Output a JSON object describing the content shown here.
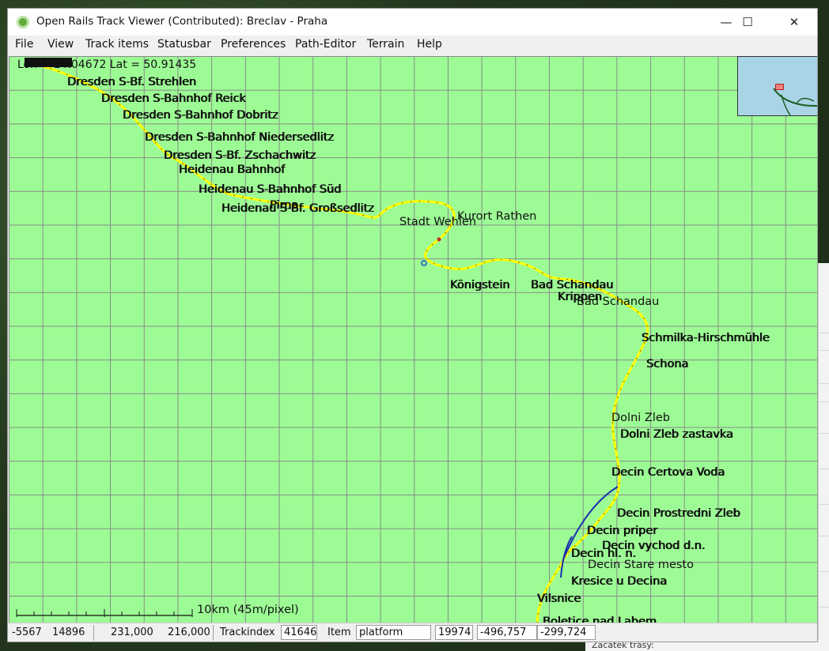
{
  "window": {
    "title": "Open Rails Track Viewer (Contributed): Breclav - Praha",
    "minimize": "—",
    "maximize": "☐",
    "close": "✕"
  },
  "menu": [
    "File",
    "View",
    "Track items",
    "Statusbar",
    "Preferences",
    "Path-Editor",
    "Terrain",
    "Help"
  ],
  "map": {
    "coordinates": "Lon = 14.04672  Lat = 50.91435",
    "scale_label": "10km (45m/pixel)",
    "stations": [
      {
        "name": "Dresden S-Bf. Strehlen"
      },
      {
        "name": "Dresden S-Bahnhof Reick"
      },
      {
        "name": "Dresden S-Bahnhof Dobritz"
      },
      {
        "name": "Dresden S-Bahnhof Niedersedlitz"
      },
      {
        "name": "Dresden S-Bf. Zschachwitz"
      },
      {
        "name": "Heidenau Bahnhof"
      },
      {
        "name": "Heidenau S-Bahnhof Süd"
      },
      {
        "name": "Heidenau S-Bf. Großsedlitz"
      },
      {
        "name": "Pirna"
      },
      {
        "name": "Stadt Wehlen"
      },
      {
        "name": "Kurort Rathen"
      },
      {
        "name": "Königstein"
      },
      {
        "name": "Bad Schandau"
      },
      {
        "name": "Krippen"
      },
      {
        "name": "Bad Schandau"
      },
      {
        "name": "Schmilka-Hirschmühle"
      },
      {
        "name": "Schona"
      },
      {
        "name": "Dolni Zleb"
      },
      {
        "name": "Dolni Zleb zastavka"
      },
      {
        "name": "Decin Certova Voda"
      },
      {
        "name": "Decin Prostredni Zleb"
      },
      {
        "name": "Decin priper"
      },
      {
        "name": "Decin vychod d.n."
      },
      {
        "name": "Decin hl. n."
      },
      {
        "name": "Decin Stare mesto"
      },
      {
        "name": "Kresice u Decina"
      },
      {
        "name": "Vilsnice"
      },
      {
        "name": "Boletice nad Labem"
      }
    ],
    "colors": {
      "background": "#9cfb94",
      "track": "#ffff00",
      "grid": "#8a8a8a"
    }
  },
  "statusbar": {
    "tile_x": "-5567",
    "tile_z": "14896",
    "x": "231,000",
    "z": "216,000",
    "trackindex_label": "Trackindex",
    "trackindex_value": "41646",
    "item_label": "Item",
    "item_value": "platform",
    "index": "19974",
    "coord1": "-496,757",
    "coord2": "-299,724"
  },
  "desktop": {
    "bottom_text": "Začátek trasy:"
  }
}
